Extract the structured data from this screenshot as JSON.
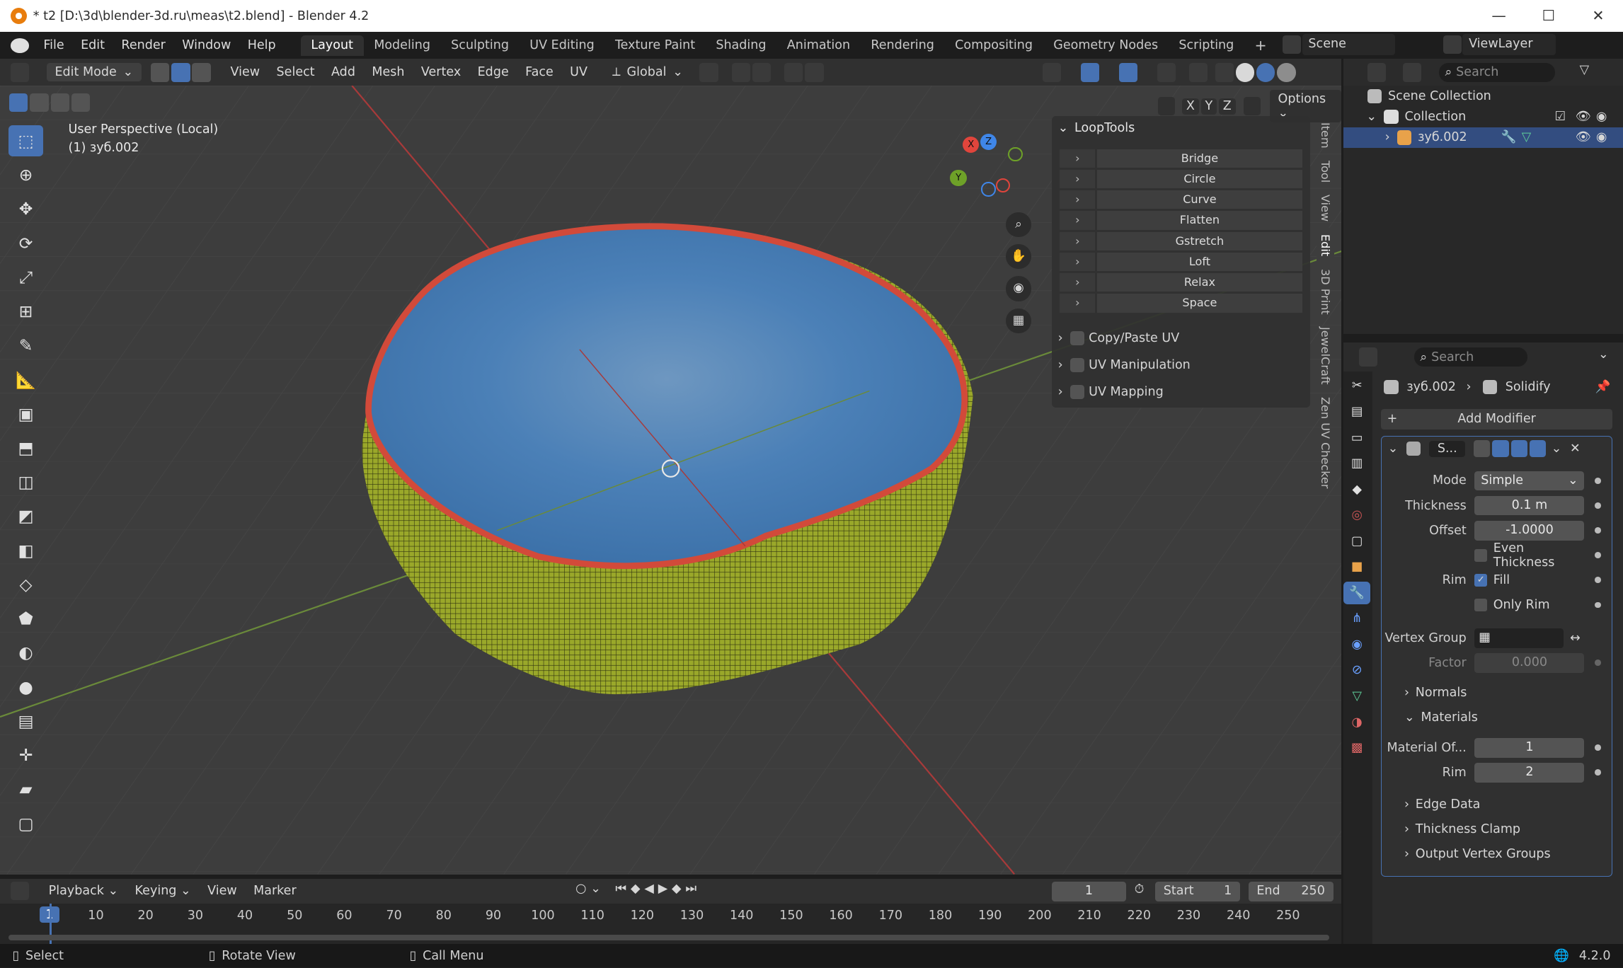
{
  "window": {
    "title": "* t2 [D:\\3d\\blender-3d.ru\\meas\\t2.blend] - Blender 4.2",
    "minimize": "—",
    "maximize": "☐",
    "close": "✕"
  },
  "menu": {
    "items": [
      "File",
      "Edit",
      "Render",
      "Window",
      "Help"
    ]
  },
  "workspaces": [
    "Layout",
    "Modeling",
    "Sculpting",
    "UV Editing",
    "Texture Paint",
    "Shading",
    "Animation",
    "Rendering",
    "Compositing",
    "Geometry Nodes",
    "Scripting"
  ],
  "scene": {
    "label": "Scene",
    "viewlayer": "ViewLayer"
  },
  "header3d": {
    "mode": "Edit Mode",
    "items": [
      "View",
      "Select",
      "Add",
      "Mesh",
      "Vertex",
      "Edge",
      "Face",
      "UV"
    ],
    "orientation": "Global",
    "options": "Options",
    "axes": [
      "X",
      "Y",
      "Z"
    ]
  },
  "viewport": {
    "perspective": "User Perspective (Local)",
    "object": "(1) зуб.002",
    "gizmo": {
      "x": "X",
      "y": "Y",
      "z": "Z"
    }
  },
  "looptools": {
    "title": "LoopTools",
    "items": [
      "Bridge",
      "Circle",
      "Curve",
      "Flatten",
      "Gstretch",
      "Loft",
      "Relax",
      "Space"
    ],
    "panels": [
      "Copy/Paste UV",
      "UV Manipulation",
      "UV Mapping"
    ]
  },
  "side_tabs": [
    "Item",
    "Tool",
    "View",
    "Edit",
    "3D Print",
    "JewelCraft",
    "Zen UV Checker"
  ],
  "outliner": {
    "search": "Search",
    "scene_collection": "Scene Collection",
    "collection": "Collection",
    "object": "зуб.002"
  },
  "properties": {
    "search": "Search",
    "object": "зуб.002",
    "modifier_crumb": "Solidify",
    "add_modifier": "Add Modifier",
    "modifier_short": "S...",
    "mode_label": "Mode",
    "mode_value": "Simple",
    "thickness_label": "Thickness",
    "thickness_value": "0.1 m",
    "offset_label": "Offset",
    "offset_value": "-1.0000",
    "even_thickness": "Even Thickness",
    "rim_label": "Rim",
    "fill": "Fill",
    "only_rim": "Only Rim",
    "vertex_group_label": "Vertex Group",
    "factor_label": "Factor",
    "factor_value": "0.000",
    "normals": "Normals",
    "materials": "Materials",
    "material_offset_label": "Material Of...",
    "material_offset_value": "1",
    "rim_mat_label": "Rim",
    "rim_mat_value": "2",
    "edge_data": "Edge Data",
    "thickness_clamp": "Thickness Clamp",
    "output_vertex_groups": "Output Vertex Groups"
  },
  "timeline": {
    "menus": [
      "Playback",
      "Keying",
      "View",
      "Marker"
    ],
    "current": "1",
    "start_label": "Start",
    "start": "1",
    "end_label": "End",
    "end": "250",
    "frames": [
      "1",
      "10",
      "20",
      "30",
      "40",
      "50",
      "60",
      "70",
      "80",
      "90",
      "100",
      "110",
      "120",
      "130",
      "140",
      "150",
      "160",
      "170",
      "180",
      "190",
      "200",
      "210",
      "220",
      "230",
      "240",
      "250"
    ]
  },
  "status": {
    "select": "Select",
    "rotate": "Rotate View",
    "call_menu": "Call Menu",
    "version": "4.2.0"
  },
  "colors": {
    "accent": "#4772b3",
    "bowl_outer": "#9aa82a",
    "bowl_inner": "#3f78b0",
    "rim": "#d24a3a"
  }
}
